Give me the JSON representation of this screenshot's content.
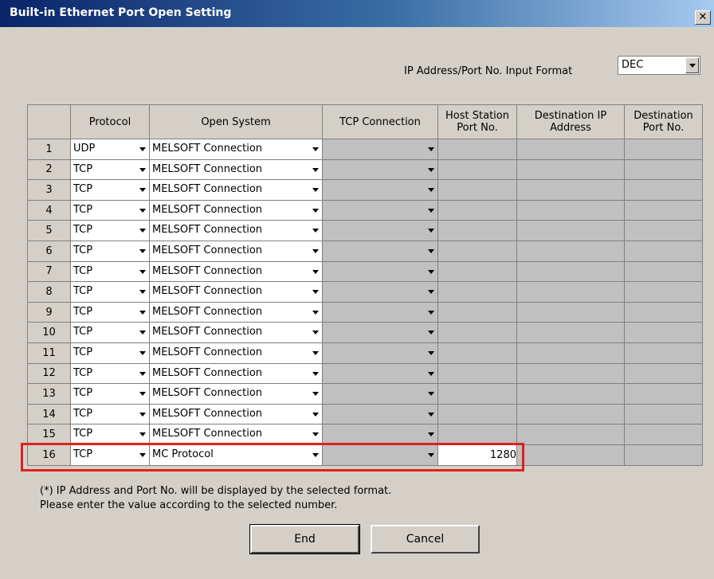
{
  "window": {
    "title": "Built-in Ethernet Port Open Setting",
    "close_glyph": "✕"
  },
  "format": {
    "label": "IP Address/Port No. Input Format",
    "value": "DEC"
  },
  "columns": [
    "",
    "Protocol",
    "Open System",
    "TCP Connection",
    "Host Station Port No.",
    "Destination IP Address",
    "Destination Port No."
  ],
  "rows": [
    {
      "num": "1",
      "protocol": "UDP",
      "open_system": "MELSOFT Connection",
      "host_port": ""
    },
    {
      "num": "2",
      "protocol": "TCP",
      "open_system": "MELSOFT Connection",
      "host_port": ""
    },
    {
      "num": "3",
      "protocol": "TCP",
      "open_system": "MELSOFT Connection",
      "host_port": ""
    },
    {
      "num": "4",
      "protocol": "TCP",
      "open_system": "MELSOFT Connection",
      "host_port": ""
    },
    {
      "num": "5",
      "protocol": "TCP",
      "open_system": "MELSOFT Connection",
      "host_port": ""
    },
    {
      "num": "6",
      "protocol": "TCP",
      "open_system": "MELSOFT Connection",
      "host_port": ""
    },
    {
      "num": "7",
      "protocol": "TCP",
      "open_system": "MELSOFT Connection",
      "host_port": ""
    },
    {
      "num": "8",
      "protocol": "TCP",
      "open_system": "MELSOFT Connection",
      "host_port": ""
    },
    {
      "num": "9",
      "protocol": "TCP",
      "open_system": "MELSOFT Connection",
      "host_port": ""
    },
    {
      "num": "10",
      "protocol": "TCP",
      "open_system": "MELSOFT Connection",
      "host_port": ""
    },
    {
      "num": "11",
      "protocol": "TCP",
      "open_system": "MELSOFT Connection",
      "host_port": ""
    },
    {
      "num": "12",
      "protocol": "TCP",
      "open_system": "MELSOFT Connection",
      "host_port": ""
    },
    {
      "num": "13",
      "protocol": "TCP",
      "open_system": "MELSOFT Connection",
      "host_port": ""
    },
    {
      "num": "14",
      "protocol": "TCP",
      "open_system": "MELSOFT Connection",
      "host_port": ""
    },
    {
      "num": "15",
      "protocol": "TCP",
      "open_system": "MELSOFT Connection",
      "host_port": ""
    },
    {
      "num": "16",
      "protocol": "TCP",
      "open_system": "MC Protocol",
      "host_port": "1280"
    }
  ],
  "notes": {
    "line1": "(*) IP Address and Port No. will be displayed by the selected format.",
    "line2": "Please enter the value according to the selected number."
  },
  "buttons": {
    "end": "End",
    "cancel": "Cancel"
  },
  "colors": {
    "highlight": "#e0201c",
    "titlebar": "#0a246a",
    "dialog_bg": "#d4d0c8"
  }
}
